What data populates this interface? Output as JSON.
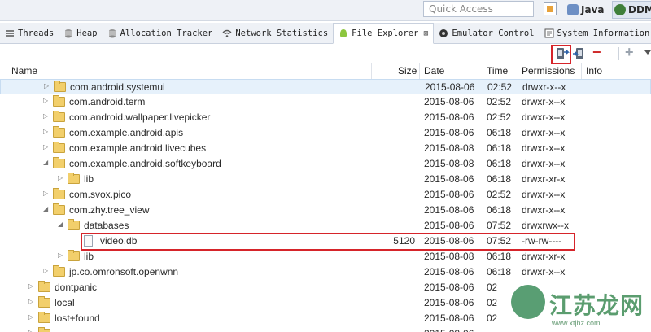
{
  "topbar": {
    "quick_access_placeholder": "Quick Access",
    "perspectives": [
      {
        "label": "Java",
        "icon": "java-perspective-icon"
      },
      {
        "label": "DDM",
        "icon": "ddms-perspective-icon"
      }
    ]
  },
  "tabs": [
    {
      "label": "Threads",
      "icon": "threads-icon"
    },
    {
      "label": "Heap",
      "icon": "heap-icon"
    },
    {
      "label": "Allocation Tracker",
      "icon": "allocation-tracker-icon"
    },
    {
      "label": "Network Statistics",
      "icon": "network-statistics-icon"
    },
    {
      "label": "File Explorer",
      "icon": "android-icon",
      "active": true,
      "close": "⊠"
    },
    {
      "label": "Emulator Control",
      "icon": "emulator-control-icon"
    },
    {
      "label": "System Information",
      "icon": "system-information-icon"
    }
  ],
  "toolbar": {
    "buttons": [
      "pull-file-from-device-icon",
      "push-file-onto-device-icon",
      "delete-icon",
      "new-folder-icon",
      "view-menu-icon"
    ],
    "delete_glyph": "−",
    "add_glyph": "+"
  },
  "columns": {
    "name": "Name",
    "size": "Size",
    "date": "Date",
    "time": "Time",
    "permissions": "Permissions",
    "info": "Info"
  },
  "rows": [
    {
      "name": "com.android.systemui",
      "size": "",
      "date": "2015-08-06",
      "time": "02:52",
      "perm": "drwxr-x--x",
      "type": "folder",
      "level": 2,
      "twisty": "▷",
      "selected": true
    },
    {
      "name": "com.android.term",
      "size": "",
      "date": "2015-08-06",
      "time": "02:52",
      "perm": "drwxr-x--x",
      "type": "folder",
      "level": 2,
      "twisty": "▷"
    },
    {
      "name": "com.android.wallpaper.livepicker",
      "size": "",
      "date": "2015-08-06",
      "time": "02:52",
      "perm": "drwxr-x--x",
      "type": "folder",
      "level": 2,
      "twisty": "▷"
    },
    {
      "name": "com.example.android.apis",
      "size": "",
      "date": "2015-08-06",
      "time": "06:18",
      "perm": "drwxr-x--x",
      "type": "folder",
      "level": 2,
      "twisty": "▷"
    },
    {
      "name": "com.example.android.livecubes",
      "size": "",
      "date": "2015-08-08",
      "time": "06:18",
      "perm": "drwxr-x--x",
      "type": "folder",
      "level": 2,
      "twisty": "▷"
    },
    {
      "name": "com.example.android.softkeyboard",
      "size": "",
      "date": "2015-08-08",
      "time": "06:18",
      "perm": "drwxr-x--x",
      "type": "folder",
      "level": 2,
      "twisty": "◢"
    },
    {
      "name": "lib",
      "size": "",
      "date": "2015-08-06",
      "time": "06:18",
      "perm": "drwxr-xr-x",
      "type": "folder",
      "level": 3,
      "twisty": "▷"
    },
    {
      "name": "com.svox.pico",
      "size": "",
      "date": "2015-08-06",
      "time": "02:52",
      "perm": "drwxr-x--x",
      "type": "folder",
      "level": 2,
      "twisty": "▷"
    },
    {
      "name": "com.zhy.tree_view",
      "size": "",
      "date": "2015-08-06",
      "time": "06:18",
      "perm": "drwxr-x--x",
      "type": "folder",
      "level": 2,
      "twisty": "◢"
    },
    {
      "name": "databases",
      "size": "",
      "date": "2015-08-06",
      "time": "07:52",
      "perm": "drwxrwx--x",
      "type": "folder",
      "level": 3,
      "twisty": "◢"
    },
    {
      "name": "video.db",
      "size": "5120",
      "date": "2015-08-06",
      "time": "07:52",
      "perm": "-rw-rw----",
      "type": "file",
      "level": 4,
      "twisty": "",
      "highlight": true
    },
    {
      "name": "lib",
      "size": "",
      "date": "2015-08-08",
      "time": "06:18",
      "perm": "drwxr-xr-x",
      "type": "folder",
      "level": 3,
      "twisty": "▷"
    },
    {
      "name": "jp.co.omronsoft.openwnn",
      "size": "",
      "date": "2015-08-06",
      "time": "06:18",
      "perm": "drwxr-x--x",
      "type": "folder",
      "level": 2,
      "twisty": "▷"
    },
    {
      "name": "dontpanic",
      "size": "",
      "date": "2015-08-06",
      "time": "02",
      "perm": "",
      "type": "folder",
      "level": 1,
      "twisty": "▷"
    },
    {
      "name": "local",
      "size": "",
      "date": "2015-08-06",
      "time": "02",
      "perm": "",
      "type": "folder",
      "level": 1,
      "twisty": "▷"
    },
    {
      "name": "lost+found",
      "size": "",
      "date": "2015-08-06",
      "time": "02",
      "perm": "",
      "type": "folder",
      "level": 1,
      "twisty": "▷"
    },
    {
      "name": "",
      "size": "",
      "date": "2015-08-06",
      "time": "",
      "perm": "",
      "type": "folder",
      "level": 1,
      "twisty": "▷"
    }
  ],
  "watermark": {
    "text": "江苏龙网",
    "url": "www.xtjhz.com"
  },
  "colors": {
    "highlight_border": "#d6242a",
    "selection": "#e6f1fb",
    "folder": "#f2cf6b"
  }
}
